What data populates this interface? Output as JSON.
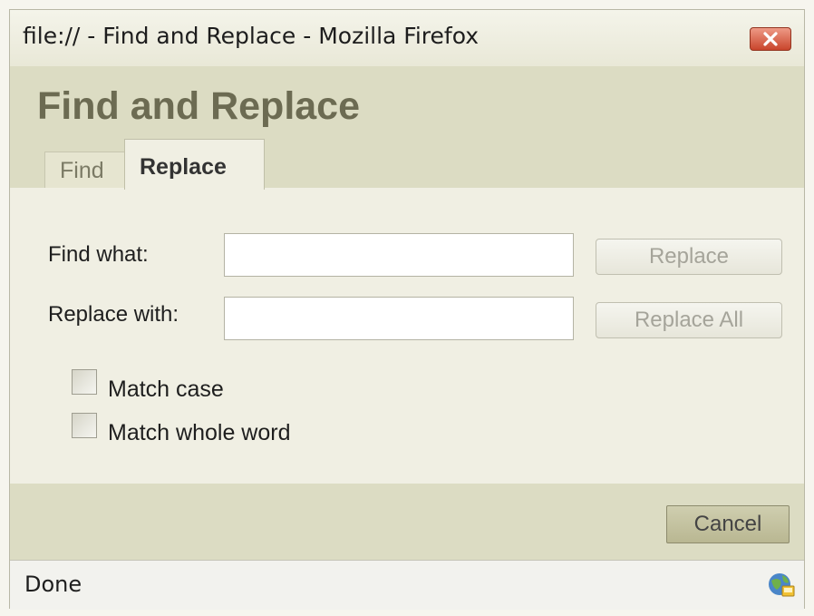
{
  "window": {
    "title": "file:// - Find and Replace - Mozilla Firefox",
    "close_icon": "close-icon"
  },
  "dialog": {
    "title": "Find and Replace",
    "tabs": [
      {
        "label": "Find",
        "selected": false
      },
      {
        "label": "Replace",
        "selected": true
      }
    ]
  },
  "form": {
    "find_label": "Find what:",
    "find_value": "",
    "replace_label": "Replace with:",
    "replace_value": "",
    "replace_button": "Replace",
    "replace_all_button": "Replace All",
    "match_case_label": "Match case",
    "match_case_checked": false,
    "match_whole_word_label": "Match whole word",
    "match_whole_word_checked": false
  },
  "footer": {
    "cancel_button": "Cancel"
  },
  "statusbar": {
    "status": "Done",
    "icon": "network-globe-icon"
  },
  "colors": {
    "header_bg": "#dcdcc3",
    "title_color": "#6c6b52",
    "close_button": "#c9452c"
  }
}
